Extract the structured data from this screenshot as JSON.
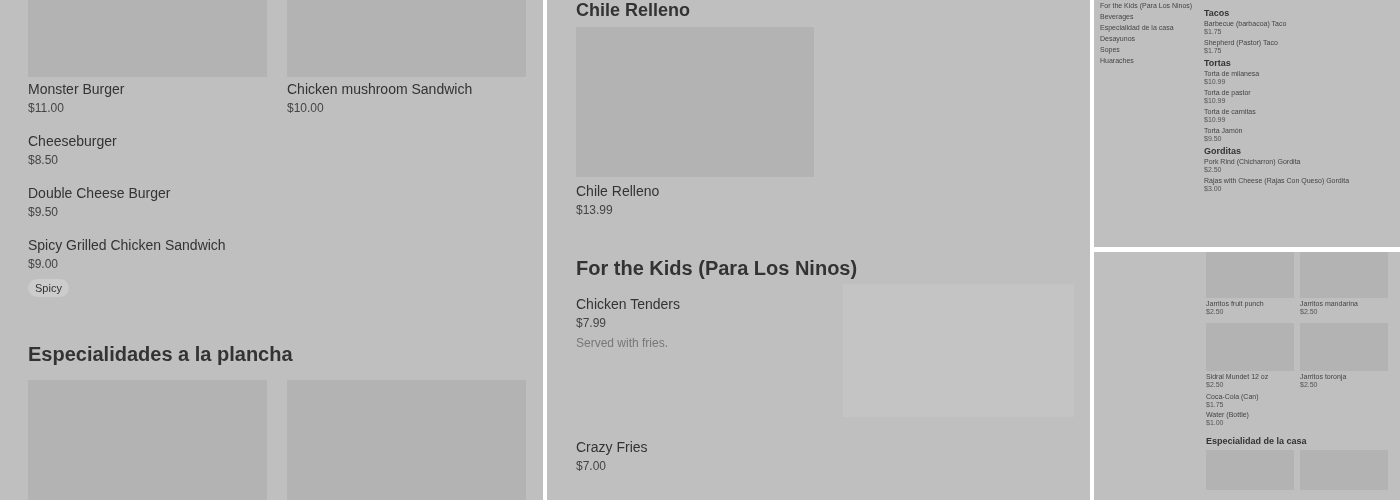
{
  "left_panel": {
    "grid_items": [
      {
        "name": "Monster Burger",
        "price": "$11.00"
      },
      {
        "name": "Chicken mushroom Sandwich",
        "price": "$10.00"
      }
    ],
    "items": [
      {
        "name": "Cheeseburger",
        "price": "$8.50"
      },
      {
        "name": "Double Cheese Burger",
        "price": "$9.50"
      },
      {
        "name": "Spicy Grilled Chicken Sandwich",
        "price": "$9.00",
        "tags": [
          "Spicy"
        ]
      }
    ],
    "section": {
      "title": "Especialidades a la plancha",
      "grid_items": [
        {
          "kind": "placeholder"
        },
        {
          "kind": "placeholder"
        }
      ]
    }
  },
  "middle_panel": {
    "cut_heading": "Chile Relleno",
    "featured": {
      "name": "Chile Relleno",
      "price": "$13.99"
    },
    "section": {
      "title": "For the Kids (Para Los Ninos)",
      "items": [
        {
          "name": "Chicken Tenders",
          "price": "$7.99",
          "description": "Served with fries.",
          "image": true
        },
        {
          "name": "Crazy Fries",
          "price": "$7.00",
          "image": false
        }
      ]
    }
  },
  "nav_panel": {
    "nav": [
      "For the Kids (Para Los Ninos)",
      "Beverages",
      "Especialidad de la casa",
      "Desayunos",
      "Sopes",
      "Huaraches"
    ],
    "sections": [
      {
        "title": "Tacos",
        "items": [
          {
            "name": "Barbecue (barbacoa) Taco",
            "price": "$1.75"
          },
          {
            "name": "Shepherd (Pastor) Taco",
            "price": "$1.75"
          }
        ]
      },
      {
        "title": "Tortas",
        "items": [
          {
            "name": "Torta de milanesa",
            "price": "$10.99"
          },
          {
            "name": "Torta de pastor",
            "price": "$10.99"
          },
          {
            "name": "Torta de carnitas",
            "price": "$10.99"
          },
          {
            "name": "Torta Jamón",
            "price": "$9.50"
          }
        ]
      },
      {
        "title": "Gorditas",
        "items": [
          {
            "name": "Pork Rind (Chicharron) Gordita",
            "price": "$2.50"
          },
          {
            "name": "Rajas with Cheese (Rajas Con Queso) Gordita",
            "price": "$3.00"
          }
        ]
      }
    ]
  },
  "drinks_panel": {
    "grid_items": [
      {
        "name": "Jarritos fruit punch",
        "price": "$2.50"
      },
      {
        "name": "Jarritos mandarina",
        "price": "$2.50"
      },
      {
        "name": "Sidral Mundet 12 oz",
        "price": "$2.50"
      },
      {
        "name": "Jarritos toronja",
        "price": "$2.50"
      }
    ],
    "items": [
      {
        "name": "Coca-Cola (Can)",
        "price": "$1.75"
      },
      {
        "name": "Water (Bottle)",
        "price": "$1.00"
      }
    ],
    "next_section": {
      "title": "Especialidad de la casa"
    }
  }
}
